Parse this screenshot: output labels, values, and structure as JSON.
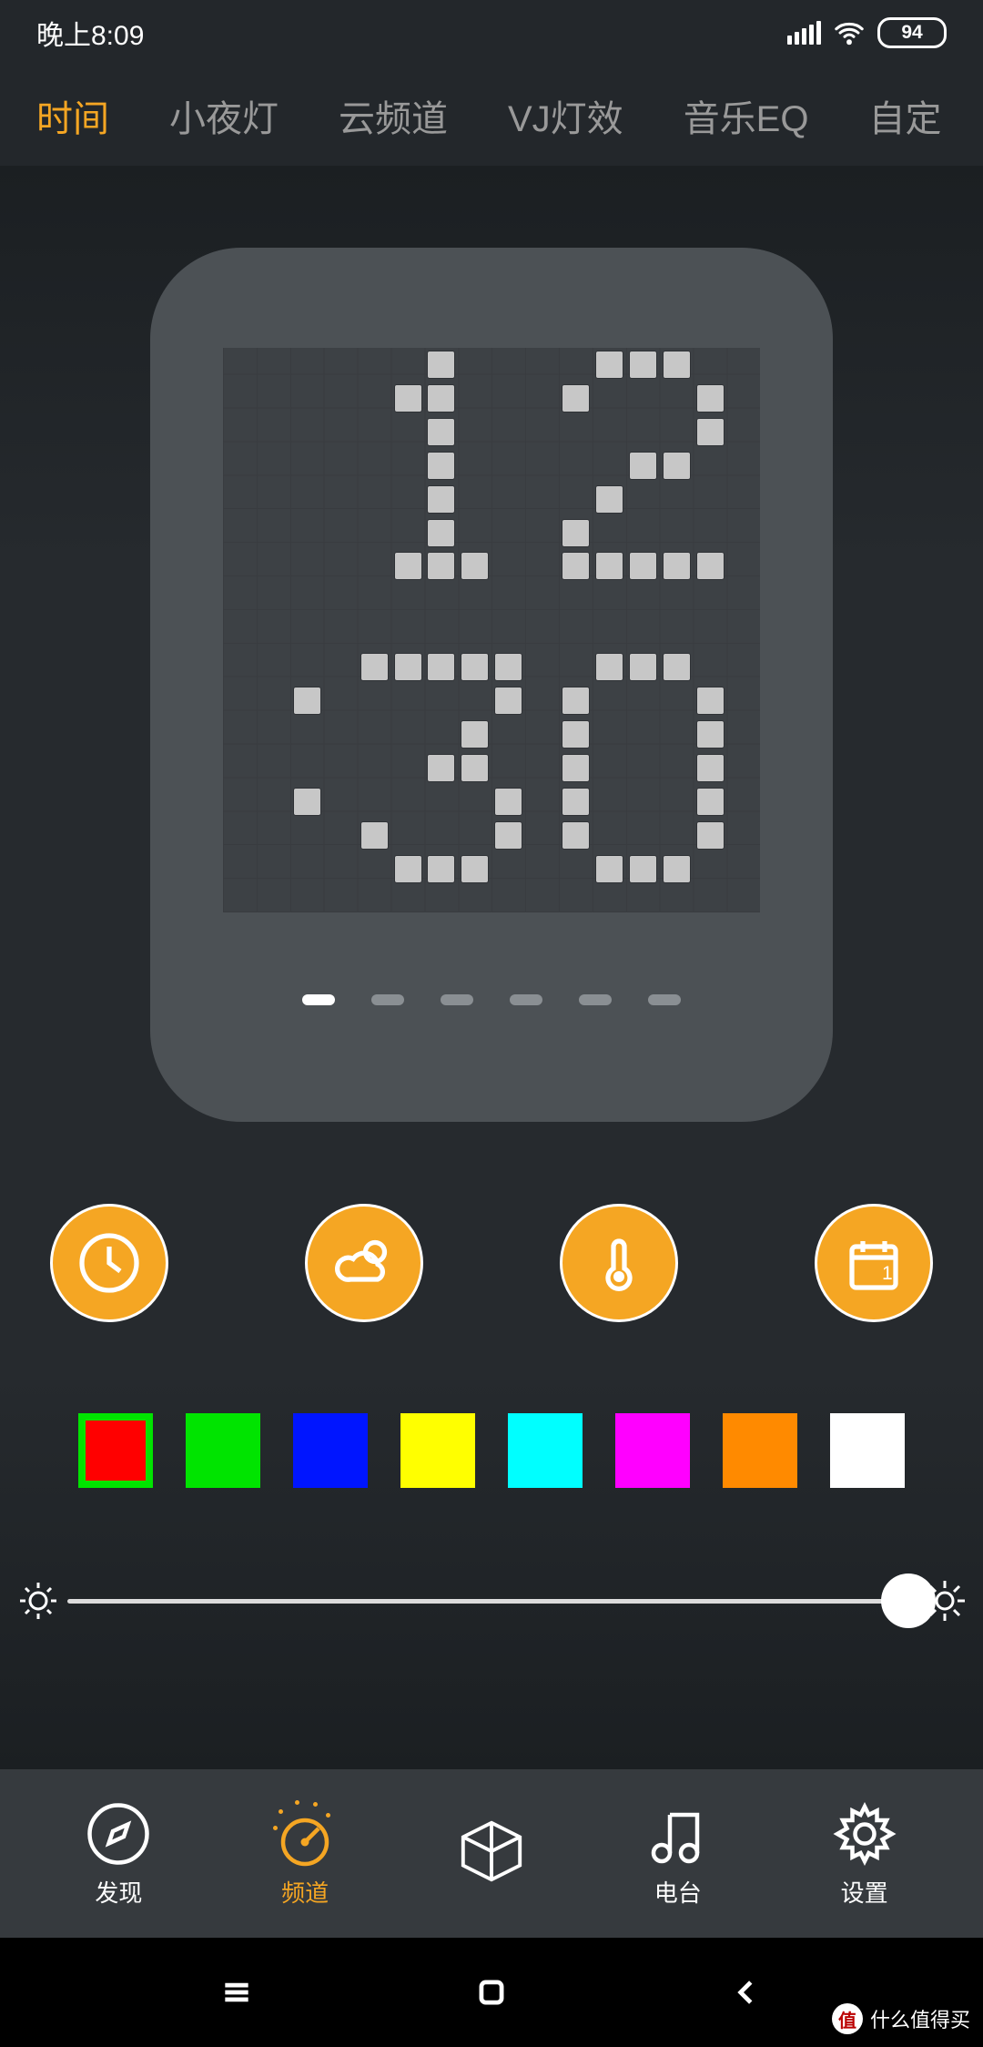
{
  "status": {
    "time": "晚上8:09",
    "battery": "94"
  },
  "top_tabs": {
    "items": [
      "时间",
      "小夜灯",
      "云频道",
      "VJ灯效",
      "音乐EQ",
      "自定"
    ],
    "active_index": 0
  },
  "clock": {
    "display_time": "12:30",
    "page_count": 6,
    "active_page": 0
  },
  "features": {
    "items": [
      "clock",
      "weather",
      "temperature",
      "calendar"
    ]
  },
  "colors": {
    "swatches": [
      "#ff0000",
      "#00e400",
      "#0015ff",
      "#ffff00",
      "#00ffff",
      "#ff00ff",
      "#ff8a00",
      "#ffffff"
    ],
    "selected_index": 0
  },
  "brightness": {
    "value": 100,
    "min": 0,
    "max": 100
  },
  "bottom_nav": {
    "items": [
      {
        "label": "发现",
        "icon": "compass"
      },
      {
        "label": "频道",
        "icon": "gauge"
      },
      {
        "label": "",
        "icon": "cube"
      },
      {
        "label": "电台",
        "icon": "music"
      },
      {
        "label": "设置",
        "icon": "gear"
      }
    ],
    "active_index": 1
  },
  "watermark": {
    "badge": "值",
    "text": "什么值得买"
  }
}
